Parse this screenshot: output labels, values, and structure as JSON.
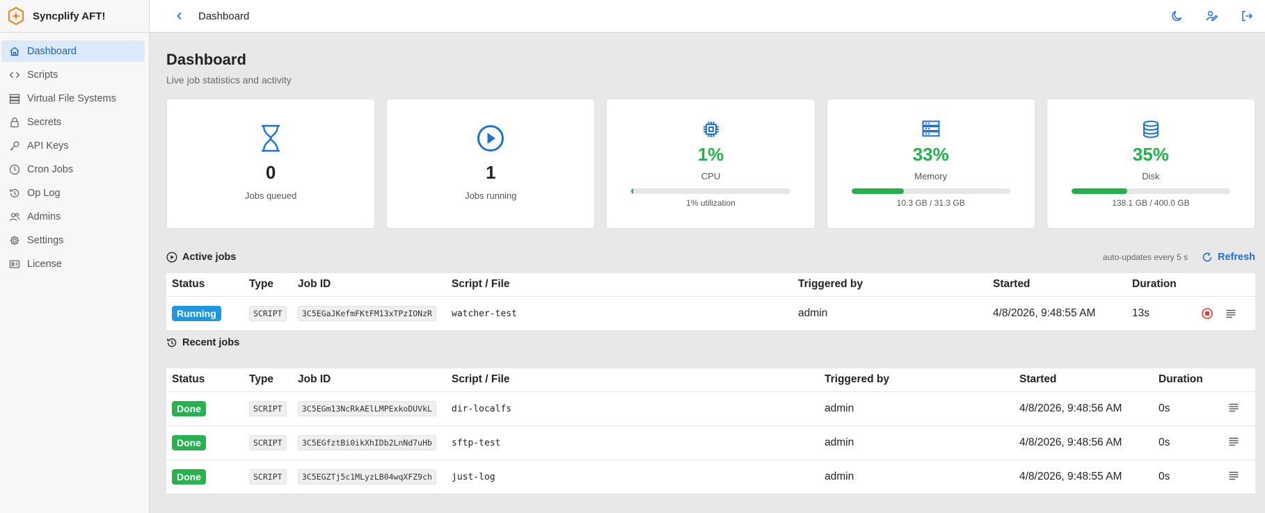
{
  "app": {
    "name": "Syncplify AFT!"
  },
  "topbar": {
    "title": "Dashboard"
  },
  "sidebar": {
    "items": [
      {
        "label": "Dashboard",
        "icon": "home-icon",
        "active": true
      },
      {
        "label": "Scripts",
        "icon": "code-icon"
      },
      {
        "label": "Virtual File Systems",
        "icon": "storage-icon"
      },
      {
        "label": "Secrets",
        "icon": "lock-icon"
      },
      {
        "label": "API Keys",
        "icon": "key-icon"
      },
      {
        "label": "Cron Jobs",
        "icon": "clock-icon"
      },
      {
        "label": "Op Log",
        "icon": "history-icon"
      },
      {
        "label": "Admins",
        "icon": "users-icon"
      },
      {
        "label": "Settings",
        "icon": "gear-icon"
      },
      {
        "label": "License",
        "icon": "id-card-icon"
      }
    ]
  },
  "page": {
    "title": "Dashboard",
    "subtitle": "Live job statistics and activity"
  },
  "stats": {
    "queued": {
      "value": "0",
      "label": "Jobs queued"
    },
    "running": {
      "value": "1",
      "label": "Jobs running"
    },
    "cpu": {
      "pct": "1%",
      "label": "CPU",
      "fraction": 0.01,
      "sub": "1% utilization"
    },
    "memory": {
      "pct": "33%",
      "label": "Memory",
      "fraction": 0.33,
      "sub": "10.3 GB / 31.3 GB"
    },
    "disk": {
      "pct": "35%",
      "label": "Disk",
      "fraction": 0.35,
      "sub": "138.1 GB / 400.0 GB"
    }
  },
  "active_jobs": {
    "title": "Active jobs",
    "auto_update": "auto-updates every 5 s",
    "refresh_label": "Refresh",
    "columns": [
      "Status",
      "Type",
      "Job ID",
      "Script / File",
      "Triggered by",
      "Started",
      "Duration"
    ],
    "rows": [
      {
        "status": "Running",
        "type": "SCRIPT",
        "job_id": "3C5EGaJKefmFKtFM13xTPzIONzR",
        "script": "watcher-test",
        "triggered_by": "admin",
        "started": "4/8/2026, 9:48:55 AM",
        "duration": "13s"
      }
    ]
  },
  "recent_jobs": {
    "title": "Recent jobs",
    "columns": [
      "Status",
      "Type",
      "Job ID",
      "Script / File",
      "Triggered by",
      "Started",
      "Duration"
    ],
    "rows": [
      {
        "status": "Done",
        "type": "SCRIPT",
        "job_id": "3C5EGm13NcRkAElLMPExkoDUVkL",
        "script": "dir-localfs",
        "triggered_by": "admin",
        "started": "4/8/2026, 9:48:56 AM",
        "duration": "0s"
      },
      {
        "status": "Done",
        "type": "SCRIPT",
        "job_id": "3C5EGfztBi0ikXhIDb2LnNd7uHb",
        "script": "sftp-test",
        "triggered_by": "admin",
        "started": "4/8/2026, 9:48:56 AM",
        "duration": "0s"
      },
      {
        "status": "Done",
        "type": "SCRIPT",
        "job_id": "3C5EGZTj5c1MLyzLB04wqXFZ9ch",
        "script": "just-log",
        "triggered_by": "admin",
        "started": "4/8/2026, 9:48:55 AM",
        "duration": "0s"
      }
    ]
  },
  "colors": {
    "accent": "#1e6fd9",
    "success": "#22b24c",
    "running": "#1f97e0",
    "stop": "#e53935"
  }
}
